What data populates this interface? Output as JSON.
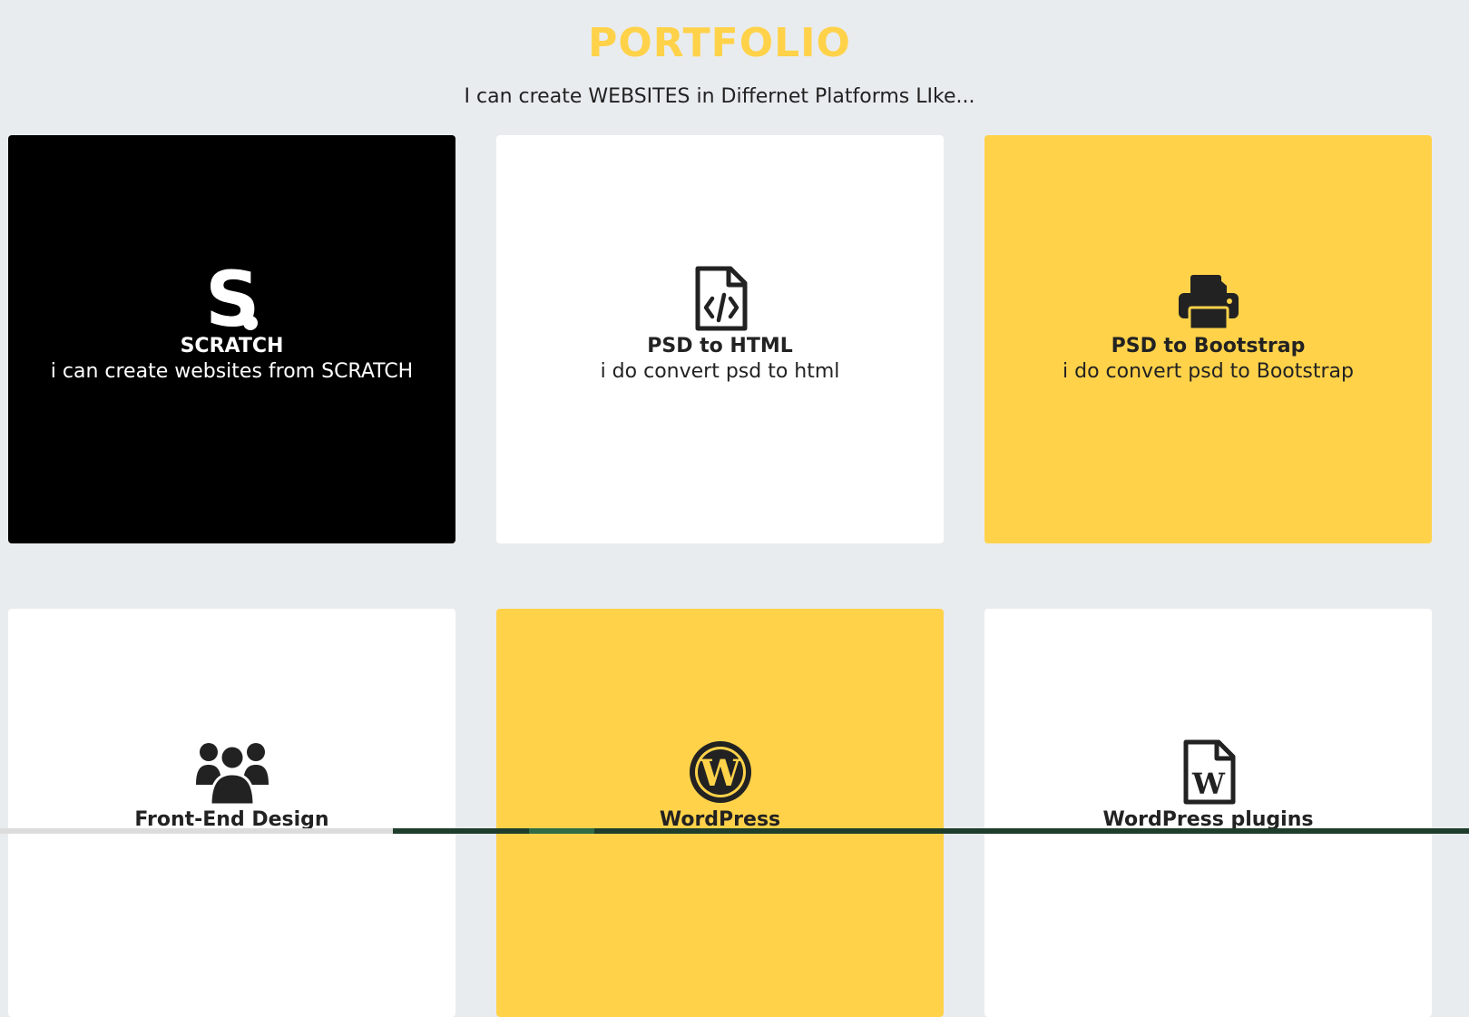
{
  "header": {
    "title": "PORTFOLIO",
    "subtitle": "I can create WEBSITES in Differnet Platforms LIke..."
  },
  "cards": [
    {
      "title": "SCRATCH",
      "desc": "i can create websites from SCRATCH",
      "icon": "scratch-s-logo-icon",
      "bg": "#000000"
    },
    {
      "title": "PSD to HTML",
      "desc": "i do convert psd to html",
      "icon": "code-file-icon",
      "bg": "#ffffff"
    },
    {
      "title": "PSD to Bootstrap",
      "desc": "i do convert psd to Bootstrap",
      "icon": "printer-icon",
      "bg": "#ffd24a"
    },
    {
      "title": "Front-End Design",
      "desc": "",
      "icon": "users-group-icon",
      "bg": "#ffffff"
    },
    {
      "title": "WordPress",
      "desc": "",
      "icon": "wordpress-icon",
      "bg": "#ffd24a"
    },
    {
      "title": "WordPress plugins",
      "desc": "",
      "icon": "word-file-icon",
      "bg": "#ffffff"
    }
  ],
  "colors": {
    "accent": "#ffd24a",
    "background": "#e9ecef",
    "text": "#222222"
  }
}
